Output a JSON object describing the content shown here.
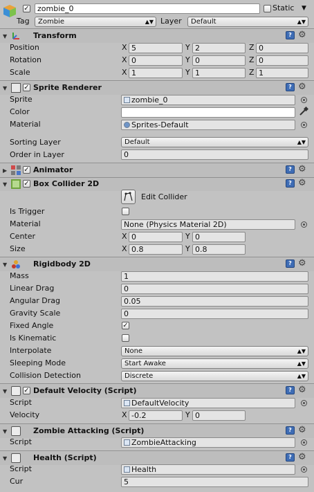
{
  "header": {
    "object_name": "zombie_0",
    "static_label": "Static",
    "tag_label": "Tag",
    "tag_value": "Zombie",
    "layer_label": "Layer",
    "layer_value": "Default"
  },
  "transform": {
    "title": "Transform",
    "position_label": "Position",
    "rotation_label": "Rotation",
    "scale_label": "Scale",
    "x": "X",
    "y": "Y",
    "z": "Z",
    "position": [
      "5",
      "2",
      "0"
    ],
    "rotation": [
      "0",
      "0",
      "0"
    ],
    "scale": [
      "1",
      "1",
      "1"
    ]
  },
  "sprite_renderer": {
    "title": "Sprite Renderer",
    "sprite_label": "Sprite",
    "sprite_value": "zombie_0",
    "color_label": "Color",
    "material_label": "Material",
    "material_value": "Sprites-Default",
    "sorting_layer_label": "Sorting Layer",
    "sorting_layer_value": "Default",
    "order_label": "Order in Layer",
    "order_value": "0"
  },
  "animator": {
    "title": "Animator"
  },
  "box_collider": {
    "title": "Box Collider 2D",
    "edit_collider_label": "Edit Collider",
    "is_trigger_label": "Is Trigger",
    "material_label": "Material",
    "material_value": "None (Physics Material 2D)",
    "center_label": "Center",
    "center": [
      "0",
      "0"
    ],
    "size_label": "Size",
    "size": [
      "0.8",
      "0.8"
    ]
  },
  "rigidbody": {
    "title": "Rigidbody 2D",
    "mass_label": "Mass",
    "mass_value": "1",
    "linear_drag_label": "Linear Drag",
    "linear_drag_value": "0",
    "angular_drag_label": "Angular Drag",
    "angular_drag_value": "0.05",
    "gravity_label": "Gravity Scale",
    "gravity_value": "0",
    "fixed_angle_label": "Fixed Angle",
    "is_kinematic_label": "Is Kinematic",
    "interpolate_label": "Interpolate",
    "interpolate_value": "None",
    "sleeping_label": "Sleeping Mode",
    "sleeping_value": "Start Awake",
    "collision_label": "Collision Detection",
    "collision_value": "Discrete"
  },
  "default_velocity": {
    "title": "Default Velocity (Script)",
    "script_label": "Script",
    "script_value": "DefaultVelocity",
    "velocity_label": "Velocity",
    "velocity": [
      "-0.2",
      "0"
    ]
  },
  "zombie_attacking": {
    "title": "Zombie Attacking (Script)",
    "script_label": "Script",
    "script_value": "ZombieAttacking"
  },
  "health": {
    "title": "Health (Script)",
    "script_label": "Script",
    "script_value": "Health",
    "cur_label": "Cur",
    "cur_value": "5"
  },
  "icons": {
    "book": "help-book-icon",
    "gear": "settings-gear-icon",
    "target": "object-picker-icon",
    "eyedropper": "eyedropper-icon",
    "checkmark": "✓"
  },
  "colors": {
    "panel": "#c2c2c2",
    "header": "#bdbdbd",
    "help_book": "#3f6db5"
  }
}
